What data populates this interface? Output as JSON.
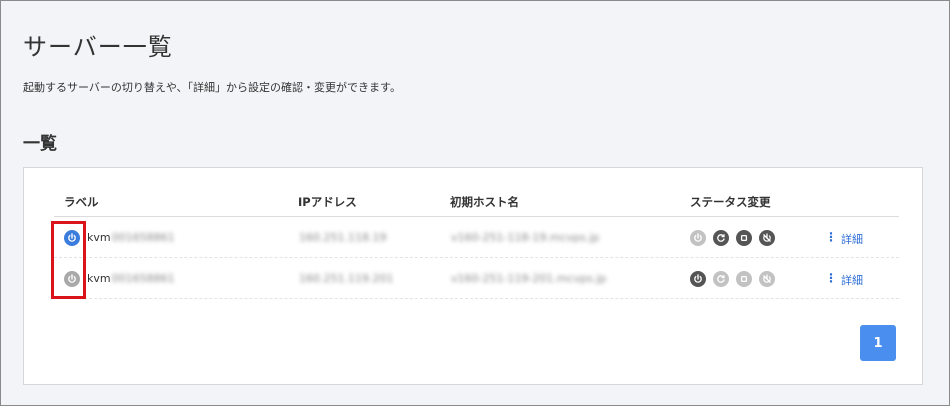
{
  "page": {
    "title": "サーバー一覧",
    "description": "起動するサーバーの切り替えや、「詳細」から設定の確認・変更ができます。",
    "section_title": "一覧"
  },
  "table": {
    "headers": {
      "label": "ラベル",
      "ip": "IPアドレス",
      "host": "初期ホスト名",
      "status": "ステータス変更"
    },
    "rows": [
      {
        "power_state": "on",
        "power_color": "#3b7ddd",
        "label_prefix": "kvm",
        "label_rest": "001658861",
        "ip": "160.251.118.19",
        "host": "v160-251-118-19.mcvps.jp",
        "status_buttons": [
          {
            "icon": "power-icon",
            "enabled": false
          },
          {
            "icon": "restart-icon",
            "enabled": true
          },
          {
            "icon": "stop-icon",
            "enabled": true
          },
          {
            "icon": "force-stop-icon",
            "enabled": true
          }
        ],
        "detail_label": "詳細"
      },
      {
        "power_state": "off",
        "power_color": "#a9a9a9",
        "label_prefix": "kvm",
        "label_rest": "001658861",
        "ip": "160.251.119.201",
        "host": "v160-251-119-201.mcvps.jp",
        "status_buttons": [
          {
            "icon": "power-icon",
            "enabled": true
          },
          {
            "icon": "restart-icon",
            "enabled": false
          },
          {
            "icon": "stop-icon",
            "enabled": false
          },
          {
            "icon": "force-stop-icon",
            "enabled": false
          }
        ],
        "detail_label": "詳細"
      }
    ]
  },
  "pagination": {
    "current": "1"
  },
  "colors": {
    "accent": "#4a8ff0",
    "link": "#2f6fd6",
    "highlight": "#d9141b"
  }
}
